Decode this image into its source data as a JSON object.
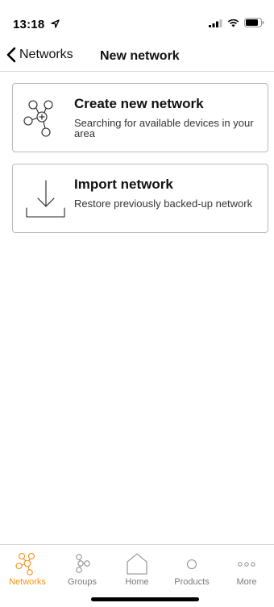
{
  "status_bar": {
    "time": "13:18",
    "icons": [
      "location-arrow-icon",
      "signal-icon",
      "wifi-icon",
      "battery-icon"
    ]
  },
  "nav": {
    "back_label": "Networks",
    "title": "New network"
  },
  "cards": [
    {
      "title": "Create new network",
      "description": "Searching for available devices in your area",
      "icon": "network-add-icon"
    },
    {
      "title": "Import network",
      "description": "Restore previously backed-up network",
      "icon": "import-download-icon"
    }
  ],
  "tabs": [
    {
      "label": "Networks",
      "icon": "networks-icon",
      "active": true
    },
    {
      "label": "Groups",
      "icon": "groups-icon",
      "active": false
    },
    {
      "label": "Home",
      "icon": "home-icon",
      "active": false
    },
    {
      "label": "Products",
      "icon": "products-icon",
      "active": false
    },
    {
      "label": "More",
      "icon": "more-icon",
      "active": false
    }
  ],
  "colors": {
    "accent": "#f39214",
    "inactive": "#7a7a7a",
    "border": "#b9b9b9"
  }
}
